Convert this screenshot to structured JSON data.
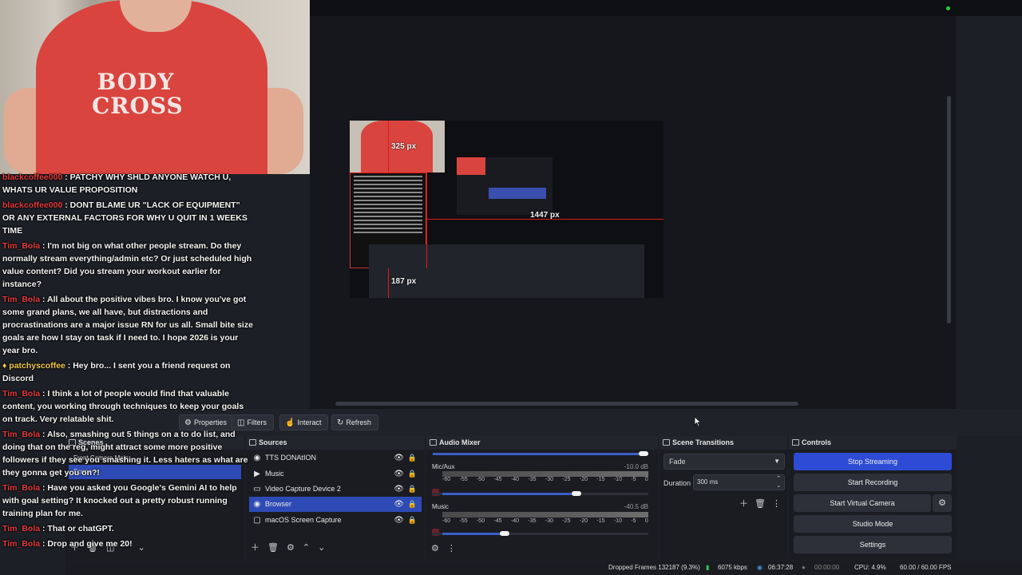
{
  "preview": {
    "labels": {
      "height_top": "325 px",
      "width": "1447 px",
      "height_bottom": "187 px"
    },
    "webcam_shirt_text": [
      "BODY",
      "CROSS"
    ]
  },
  "chat": [
    {
      "user": "blackcoffee000",
      "text": ": PATCHY WHY SHLD ANYONE WATCH U, WHATS UR VALUE PROPOSITION"
    },
    {
      "user": "blackcoffee000",
      "text": ": DONT BLAME UR \"LACK OF EQUIPMENT\" OR ANY EXTERNAL FACTORS FOR WHY U QUIT IN 1 WEEKS TIME"
    },
    {
      "user": "Tim_Bola",
      "text": ": I'm not big on what other people stream. Do they normally stream everything/admin etc? Or just scheduled high value content? Did you stream your workout earlier for instance?"
    },
    {
      "user": "Tim_Bola",
      "text": ": All about the positive vibes bro. I know you've got some grand plans, we all have, but distractions and procrastinations are a major issue RN for us all. Small bite size goals are how I stay on task if I need to. I hope 2026 is your year bro."
    },
    {
      "user": "patchyscoffee",
      "text": ": Hey bro... I sent you a friend request on Discord"
    },
    {
      "user": "Tim_Bola",
      "text": ": I think a lot of people would find that valuable content, you working through techniques to keep your goals on track. Very relatable shit."
    },
    {
      "user": "Tim_Bola",
      "text": ": Also, smashing out 5 things on a to do list, and doing that on the reg, might attract some more positive followers if they see you smashing it. Less haters as what are they gonna get you on?!"
    },
    {
      "user": "Tim_Bola",
      "text": ": Have you asked you Google's Gemini AI to help with goal setting? It knocked out a pretty robust running training plan for me."
    },
    {
      "user": "Tim_Bola",
      "text": ": That or chatGPT."
    },
    {
      "user": "Tim_Bola",
      "text": ": Drop and give me 20!"
    }
  ],
  "dockbar": {
    "properties": "Properties",
    "filters": "Filters",
    "interact": "Interact",
    "refresh": "Refresh"
  },
  "scenes": {
    "title": "Scenes",
    "items": [
      "Front Camera Main",
      "Scene"
    ]
  },
  "sources": {
    "title": "Sources",
    "items": [
      {
        "label": "TTS DONAtION",
        "icon": "globe-icon"
      },
      {
        "label": "Music",
        "icon": "play-icon"
      },
      {
        "label": "Video Capture Device 2",
        "icon": "camera-icon"
      },
      {
        "label": "Browser",
        "icon": "globe-icon"
      },
      {
        "label": "macOS Screen Capture",
        "icon": "monitor-icon"
      }
    ],
    "selected_index": 3
  },
  "mixer": {
    "title": "Audio Mixer",
    "channels": [
      {
        "name": "Mic/Aux",
        "db": "-10.0 dB",
        "volume": 0.66
      },
      {
        "name": "Music",
        "db": "-40.5 dB",
        "volume": 0.27
      }
    ],
    "ticks": [
      "-60",
      "-55",
      "-50",
      "-45",
      "-40",
      "-35",
      "-30",
      "-25",
      "-20",
      "-15",
      "-10",
      "-5",
      "0"
    ]
  },
  "transitions": {
    "title": "Scene Transitions",
    "selected": "Fade",
    "duration_label": "Duration",
    "duration_value": "300 ms"
  },
  "controls": {
    "title": "Controls",
    "stop_streaming": "Stop Streaming",
    "start_recording": "Start Recording",
    "start_virtual_camera": "Start Virtual Camera",
    "studio_mode": "Studio Mode",
    "settings": "Settings"
  },
  "status": {
    "dropped": "Dropped Frames 132187 (9.3%)",
    "bitrate": "6075 kbps",
    "stream_time": "06:37:28",
    "rec_time": "00:00:00",
    "cpu": "CPU: 4.9%",
    "fps": "60.00 / 60.00 FPS"
  },
  "colors": {
    "accent": "#2e4bd6",
    "selected_row": "#2e4bb5",
    "chat_user": "#e23a3a"
  }
}
